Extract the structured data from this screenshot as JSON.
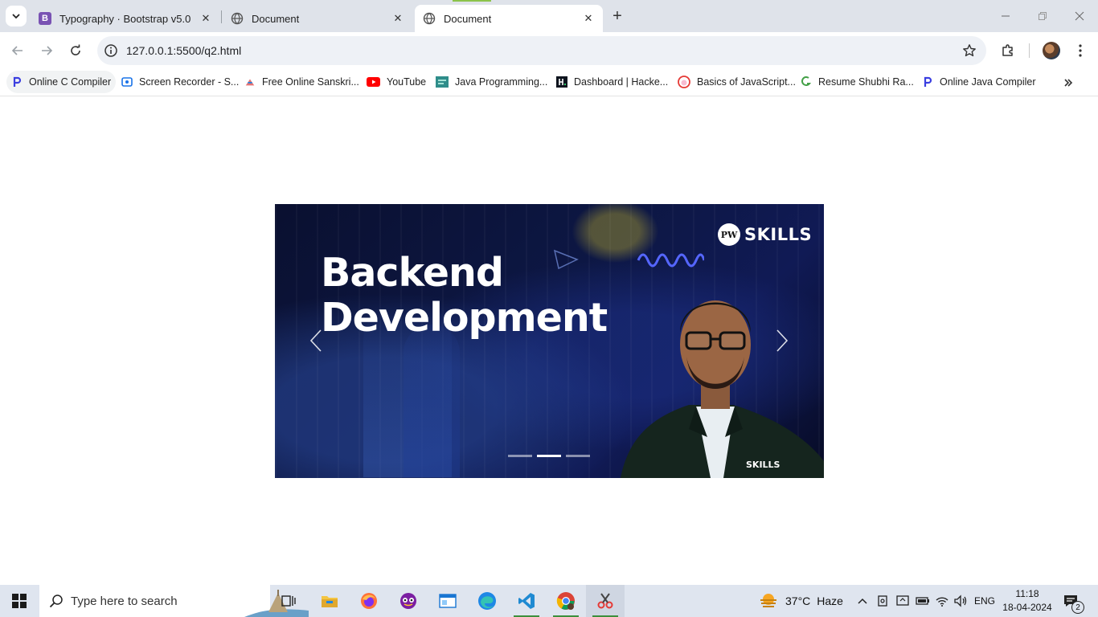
{
  "browser": {
    "tabs": [
      {
        "title": "Typography · Bootstrap v5.0",
        "active": false
      },
      {
        "title": "Document",
        "active": false
      },
      {
        "title": "Document",
        "active": true
      }
    ],
    "url": "127.0.0.1:5500/q2.html",
    "bookmarks": [
      {
        "label": "Online C Compiler",
        "icon": "programiz-icon"
      },
      {
        "label": "Screen Recorder - S...",
        "icon": "screen-recorder-icon"
      },
      {
        "label": "Free Online Sanskri...",
        "icon": "sanskrit-icon"
      },
      {
        "label": "YouTube",
        "icon": "youtube-icon"
      },
      {
        "label": "Java Programming...",
        "icon": "java-icon"
      },
      {
        "label": "Dashboard | Hacke...",
        "icon": "hackerrank-icon"
      },
      {
        "label": "Basics of JavaScript...",
        "icon": "javascript-icon"
      },
      {
        "label": "Resume Shubhi Ra...",
        "icon": "resume-icon"
      },
      {
        "label": "Online Java Compiler",
        "icon": "programiz-icon"
      }
    ]
  },
  "carousel": {
    "headline_line1": "Backend",
    "headline_line2": "Development",
    "logo_text": "SKILLS",
    "logo_badge": "PW",
    "shirt_logo": "SKILLS",
    "slide_count": 3,
    "active_slide": 2
  },
  "taskbar": {
    "search_placeholder": "Type here to search",
    "weather": {
      "temp": "37°C",
      "condition": "Haze"
    },
    "language": "ENG",
    "time": "11:18",
    "date": "18-04-2024",
    "notification_count": "2"
  }
}
